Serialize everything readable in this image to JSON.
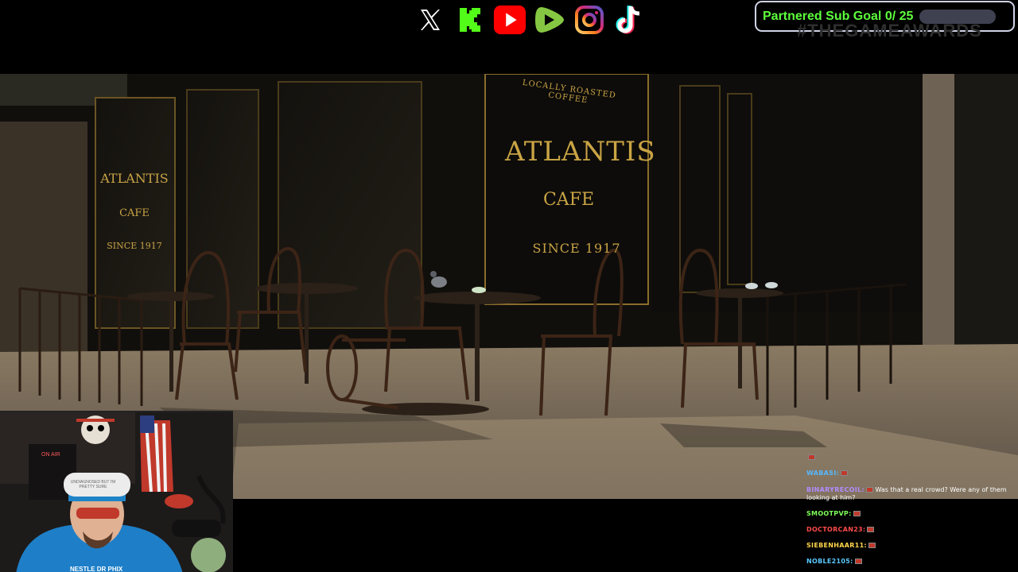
{
  "socials": [
    {
      "name": "x-icon",
      "color": "#ffffff"
    },
    {
      "name": "kick-icon",
      "color": "#53fc18"
    },
    {
      "name": "youtube-icon",
      "color": "#ff0000"
    },
    {
      "name": "rumble-icon",
      "color": "#85c742"
    },
    {
      "name": "instagram-icon",
      "color": "#d6249f"
    },
    {
      "name": "tiktok-icon",
      "color": "#ffffff"
    }
  ],
  "sub_goal": {
    "label": "Partnered Sub Goal 0/ 25",
    "current": 0,
    "target": 25,
    "progress": 0,
    "label_color": "#5dff3c"
  },
  "watermark": "#THEGAMEAWARDS",
  "scene": {
    "window_sign": {
      "line1": "LOCALLY ROASTED COFFEE",
      "line2": "ATLANTIS",
      "line3": "CAFE",
      "line4": "SINCE 1917"
    },
    "left_sign": {
      "line1": "ATLANTIS",
      "line2": "CAFE",
      "line3": "SINCE 1917"
    }
  },
  "webcam": {
    "on_air": "ON AIR",
    "hat_text": "UNDIAGNOSED BUT I'M PRETTY SURE",
    "shirt_text": "NESTLE DR PHIX"
  },
  "chat": [
    {
      "user": "",
      "msg": "",
      "color": "#ff8fb0"
    },
    {
      "user": "WABASI:",
      "msg": "",
      "color": "#58b8ff"
    },
    {
      "user": "BINARYRECOIL:",
      "msg": "Was that a real crowd? Were any of them looking at him?",
      "color": "#b08cff"
    },
    {
      "user": "SMOOTPVP:",
      "msg": "",
      "color": "#7dff5a"
    },
    {
      "user": "DOCTORCAN23:",
      "msg": "",
      "color": "#ff4b4b"
    },
    {
      "user": "SIEBENHAAR11:",
      "msg": "",
      "color": "#ffd54a"
    },
    {
      "user": "NOBLE2105:",
      "msg": "",
      "color": "#5ac8ff"
    }
  ]
}
